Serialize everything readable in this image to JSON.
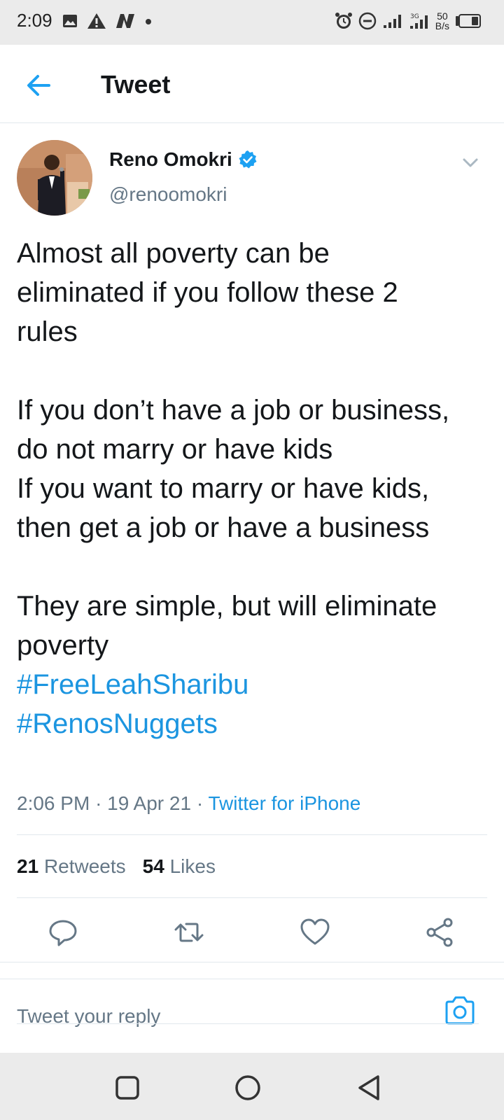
{
  "status_bar": {
    "time": "2:09",
    "network_speed_value": "50",
    "network_speed_unit": "B/s",
    "signal_label": "3G"
  },
  "header": {
    "title": "Tweet"
  },
  "tweet": {
    "author_name": "Reno Omokri",
    "author_handle": "@renoomokri",
    "verified": true,
    "body": "Almost all poverty can be\neliminated if you follow these 2\nrules\n\nIf you don’t have a job or business,\ndo not marry or have kids\nIf you want to marry or have kids,\nthen get a job or have a business\n\nThey are simple, but will eliminate\npoverty\n",
    "hashtags": [
      "#FreeLeahSharibu",
      "#RenosNuggets"
    ],
    "time": "2:06 PM",
    "separator": "·",
    "date": "19 Apr 21",
    "source": "Twitter for iPhone"
  },
  "stats": {
    "retweets_count": "21",
    "retweets_label": "Retweets",
    "likes_count": "54",
    "likes_label": "Likes"
  },
  "reply": {
    "placeholder": "Tweet your reply"
  },
  "colors": {
    "accent": "#1b95e0",
    "text_primary": "#14171a",
    "text_secondary": "#657786",
    "verified_badge": "#1da1f2",
    "divider": "#e1e8ed",
    "system_bar": "#ebebeb"
  },
  "icons": {
    "back": "arrow-left-icon",
    "verified": "verified-badge-icon",
    "caret": "chevron-down-icon",
    "reply": "speech-bubble-icon",
    "retweet": "retweet-icon",
    "like": "heart-icon",
    "share": "share-icon",
    "camera": "camera-icon",
    "nav_recents": "square-icon",
    "nav_home": "circle-icon",
    "nav_back": "triangle-back-icon"
  }
}
